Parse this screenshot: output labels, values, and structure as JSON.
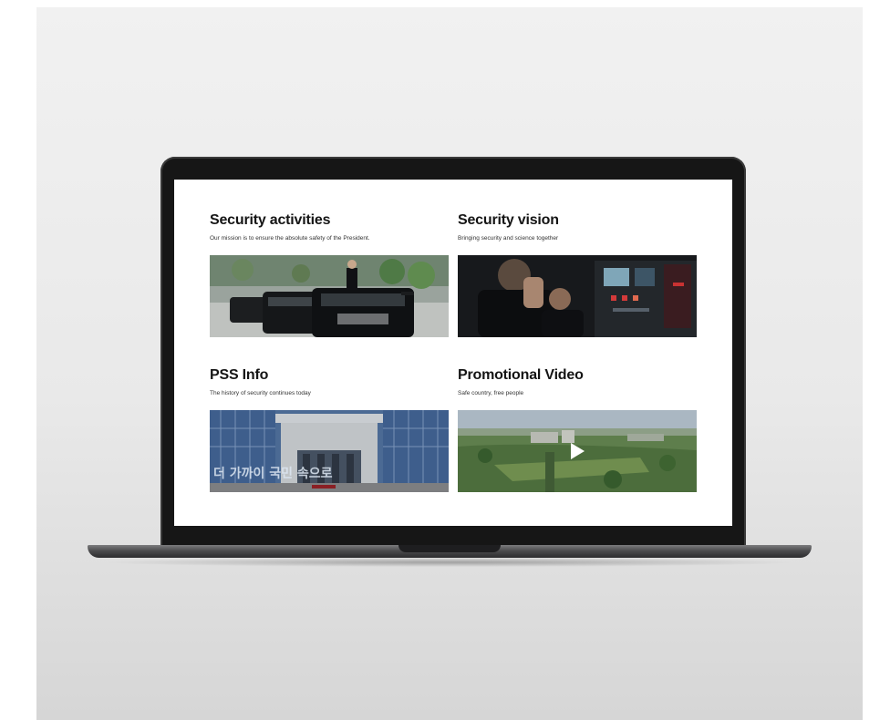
{
  "cards": [
    {
      "title": "Security activities",
      "subtitle": "Our mission is to ensure the absolute safety of the President.",
      "image_alt": "Motorcade of black SUVs with a person standing through the roof"
    },
    {
      "title": "Security vision",
      "subtitle": "Bringing security and science together",
      "image_alt": "Security staff wearing headsets in a dark control room"
    },
    {
      "title": "PSS Info",
      "subtitle": "The history of security continues today",
      "image_alt": "Glass building entrance with Korean lettering",
      "image_text": "더 가까이 국민 속으로"
    },
    {
      "title": "Promotional Video",
      "subtitle": "Safe country, free people",
      "image_alt": "Aerial view of a green city park with a play button"
    }
  ]
}
